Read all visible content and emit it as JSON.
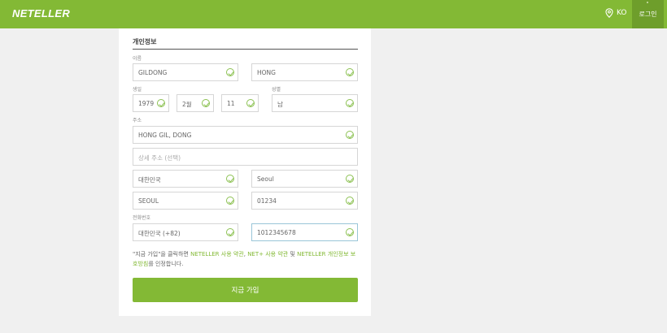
{
  "header": {
    "logo": "NETELLER",
    "language": "KO",
    "login_label": "로그인"
  },
  "form": {
    "section_title": "개인정보",
    "name": {
      "label": "이름",
      "first": "GILDONG",
      "last": "HONG"
    },
    "birth": {
      "label": "생일",
      "year": "1979",
      "month": "2월",
      "day": "11"
    },
    "gender": {
      "label": "성별",
      "value": "남"
    },
    "address": {
      "label": "주소",
      "line1": "HONG GIL, DONG",
      "line2_placeholder": "상세 주소 (선택)",
      "country": "대한민국",
      "region": "Seoul",
      "city": "SEOUL",
      "postal_code": "01234"
    },
    "phone": {
      "label": "전화번호",
      "country_code": "대한민국 (+82)",
      "number": "1012345678"
    },
    "terms": {
      "part1": "\"지금 가입\"을 클릭하면 ",
      "link1": "NETELLER 사용 약관",
      "part2": ", ",
      "link2": "NET+ 사용 약관",
      "part3": " 및 ",
      "link3": "NETELLER 개인정보 보호방침",
      "part4": "를 인정합니다."
    },
    "submit_label": "지금 가입"
  },
  "colors": {
    "brand": "#83b935",
    "brand_dark": "#6e9e2b",
    "background": "#f0f0f0",
    "focus_border": "#9ac6d8"
  },
  "icons": {
    "language": "location-pin-icon",
    "field_valid": "check-circle-icon"
  }
}
